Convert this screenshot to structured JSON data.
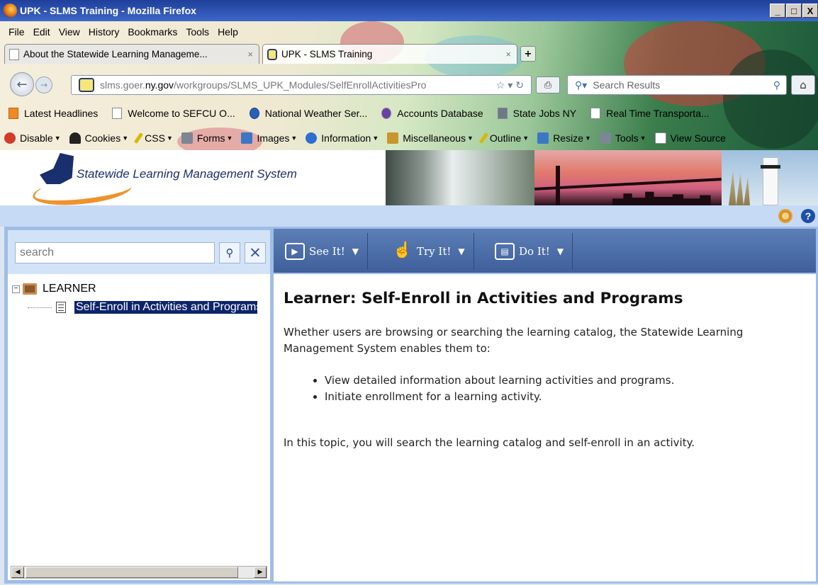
{
  "window": {
    "title": "UPK - SLMS Training - Mozilla Firefox",
    "buttons": [
      "_",
      "□",
      "X"
    ]
  },
  "menu": [
    "File",
    "Edit",
    "View",
    "History",
    "Bookmarks",
    "Tools",
    "Help"
  ],
  "tabs": [
    {
      "label": "About the Statewide Learning Manageme...",
      "close": "×"
    },
    {
      "label": "UPK - SLMS Training",
      "close": "×"
    }
  ],
  "newtab": "+",
  "nav": {
    "url_prefix": "slms.goer.",
    "url_domain": "ny.gov",
    "url_path": "/workgroups/SLMS_UPK_Modules/SelfEnrollActivitiesPro",
    "search_placeholder": "Search Results"
  },
  "bookmarks": [
    {
      "label": "Latest Headlines",
      "icon": "rss"
    },
    {
      "label": "Welcome to SEFCU O...",
      "icon": "page"
    },
    {
      "label": "National Weather Ser...",
      "icon": "blue"
    },
    {
      "label": "Accounts Database",
      "icon": "purple"
    },
    {
      "label": "State Jobs NY",
      "icon": "gray"
    },
    {
      "label": "Real Time Transporta...",
      "icon": "page"
    }
  ],
  "devbar": [
    {
      "label": "Disable",
      "icon": "red"
    },
    {
      "label": "Cookies",
      "icon": "blk"
    },
    {
      "label": "CSS",
      "icon": "pen"
    },
    {
      "label": "Forms",
      "icon": "gry"
    },
    {
      "label": "Images",
      "icon": "blu"
    },
    {
      "label": "Information",
      "icon": "info"
    },
    {
      "label": "Miscellaneous",
      "icon": "yel"
    },
    {
      "label": "Outline",
      "icon": "pen"
    },
    {
      "label": "Resize",
      "icon": "blu"
    },
    {
      "label": "Tools",
      "icon": "gry"
    },
    {
      "label": "View Source",
      "icon": "page"
    }
  ],
  "header": {
    "title": "Statewide Learning Management System"
  },
  "left": {
    "search_placeholder": "search",
    "tree": {
      "root": "LEARNER",
      "child": "Self-Enroll in Activities and Programs"
    }
  },
  "toolbar": [
    {
      "label": "See It!"
    },
    {
      "label": "Try It!"
    },
    {
      "label": "Do It!"
    }
  ],
  "content": {
    "heading": "Learner:  Self-Enroll in Activities and Programs",
    "intro": "Whether users are browsing or searching the learning catalog, the Statewide Learning Management System enables them to:",
    "bullets": [
      "View detailed information about learning activities and programs.",
      "Initiate enrollment for a learning activity."
    ],
    "closing": "In this topic, you will search the learning catalog and self-enroll in an activity."
  }
}
